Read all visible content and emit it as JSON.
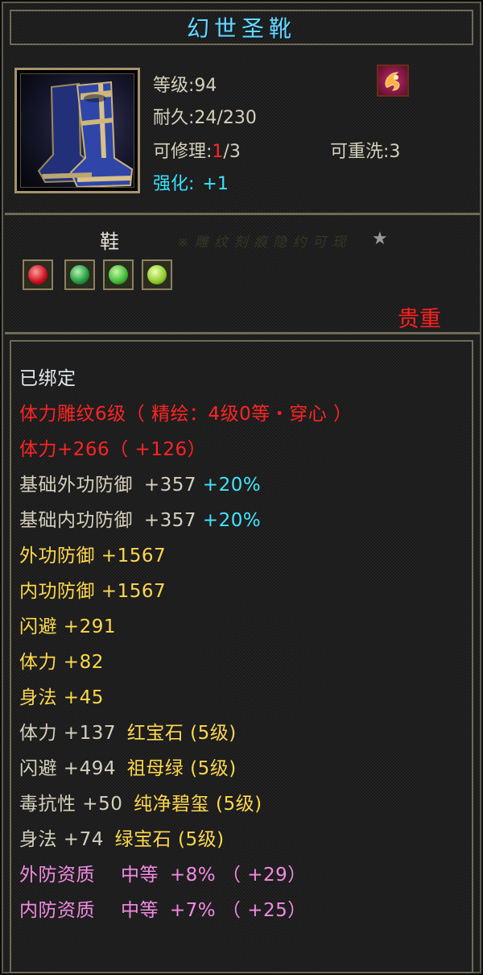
{
  "item": {
    "name": "幻世圣靴",
    "icon": "blue-gold-boots-icon",
    "level_label": "等级:94",
    "durability_label": "耐久:24/230",
    "repair_prefix": "可修理:",
    "repair_current": "1",
    "repair_suffix": "/3",
    "rewash_label": "可重洗:3",
    "enhance_label": "强化:",
    "enhance_value": "+1",
    "rune_icon": "crimson-rune-icon",
    "type_label": "鞋",
    "engrave_hint": "※ 雕 纹 刻 痕 隐 约 可 现",
    "star_icon": "grey-star-icon",
    "rarity": "贵重"
  },
  "gems": [
    {
      "name": "ruby-gem-icon",
      "color": "#e0202a"
    },
    {
      "name": "emerald-gem-icon",
      "color": "#2fa84a"
    },
    {
      "name": "jade-gem-icon",
      "color": "#44c03a"
    },
    {
      "name": "peridot-gem-icon",
      "color": "#7ccf2e"
    }
  ],
  "attributes": {
    "bound": "已绑定",
    "engraving": "体力雕纹6级（ 精绘：4级0等・穿心 ）",
    "stamina_base": "体力+266（ +126）",
    "basic_ext_def": {
      "label": "基础外功防御",
      "value": "+357",
      "bonus": "+20%"
    },
    "basic_int_def": {
      "label": "基础内功防御",
      "value": "+357",
      "bonus": "+20%"
    },
    "ext_def": "外功防御 +1567",
    "int_def": "内功防御 +1567",
    "dodge": "闪避 +291",
    "stamina": "体力 +82",
    "agility": "身法 +45",
    "gem_lines": [
      {
        "stat": "体力 +137",
        "gem": "红宝石 (5级)"
      },
      {
        "stat": "闪避 +494",
        "gem": "祖母绿 (5级)"
      },
      {
        "stat": "毒抗性 +50",
        "gem": "纯净碧玺 (5级)"
      },
      {
        "stat": "身法 +74",
        "gem": "绿宝石 (5级)"
      }
    ],
    "qualities": [
      {
        "label": "外防资质",
        "grade": "中等",
        "value": "+8% （ +29）"
      },
      {
        "label": "内防资质",
        "grade": "中等",
        "value": "+7% （ +25）"
      }
    ]
  }
}
